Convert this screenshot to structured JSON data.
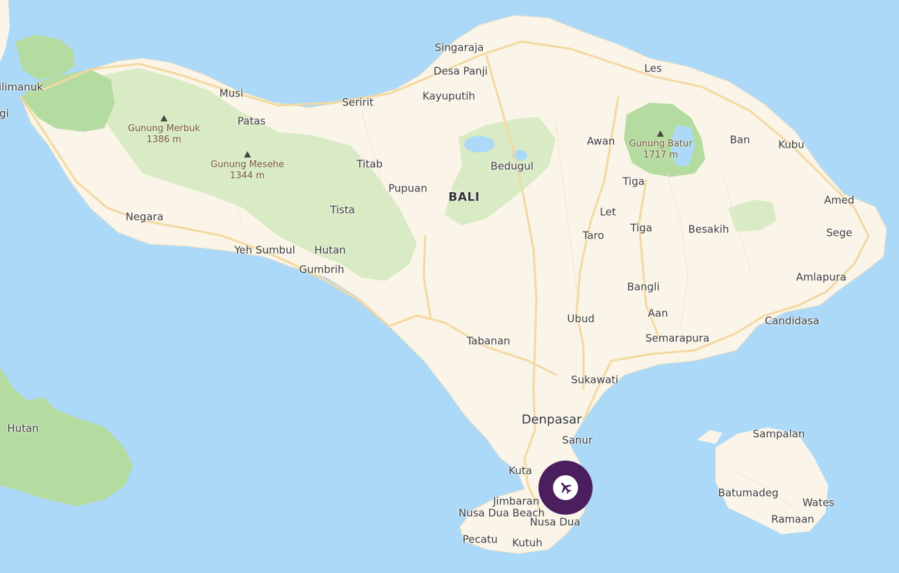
{
  "colors": {
    "water": "#acd9f8",
    "land": "#faf5e8",
    "park": "#d9ebc4",
    "forest": "#b5dca0",
    "road": "#f3d9a0",
    "airport_marker": "#4b1f5e"
  },
  "places": {
    "gilimanuk": "ilimanuk",
    "gi": "gi",
    "musi": "Musi",
    "patas": "Patas",
    "seririt": "Seririt",
    "singaraja": "Singaraja",
    "desa_panji": "Desa Panji",
    "kayuputih": "Kayuputih",
    "les": "Les",
    "awan": "Awan",
    "ban": "Ban",
    "kubu": "Kubu",
    "titab": "Titab",
    "bedugul": "Bedugul",
    "pupuan": "Pupuan",
    "tiga1": "Tiga",
    "tista": "Tista",
    "let": "Let",
    "amed": "Amed",
    "negara": "Negara",
    "taro": "Taro",
    "tiga2": "Tiga",
    "besakih": "Besakih",
    "sege": "Sege",
    "yeh_sumbul": "Yeh Sumbul",
    "hutan_bali": "Hutan",
    "gumbrih": "Gumbrih",
    "amlapura": "Amlapura",
    "bangli": "Bangli",
    "aan": "Aan",
    "ubud": "Ubud",
    "candidasa": "Candidasa",
    "tabanan": "Tabanan",
    "semarapura": "Semarapura",
    "sukawati": "Sukawati",
    "denpasar": "Denpasar",
    "sanur": "Sanur",
    "kuta": "Kuta",
    "jimbaran": "Jimbaran",
    "nusa_dua_beach": "Nusa Dua Beach",
    "nusa_dua": "Nusa Dua",
    "pecatu": "Pecatu",
    "kutuh": "Kutuh",
    "hutan_west": "Hutan",
    "sampalan": "Sampalan",
    "batumadeg": "Batumadeg",
    "wates": "Wates",
    "ramaan": "Ramaan"
  },
  "region_label": "BALI",
  "peaks": {
    "merbuk": {
      "name": "Gunung Merbuk",
      "elevation": "1386 m"
    },
    "mesehe": {
      "name": "Gunung Mesehe",
      "elevation": "1344 m"
    },
    "batur": {
      "name": "Gunung Batur",
      "elevation": "1717 m"
    }
  },
  "airport": {
    "icon": "airplane-icon"
  }
}
